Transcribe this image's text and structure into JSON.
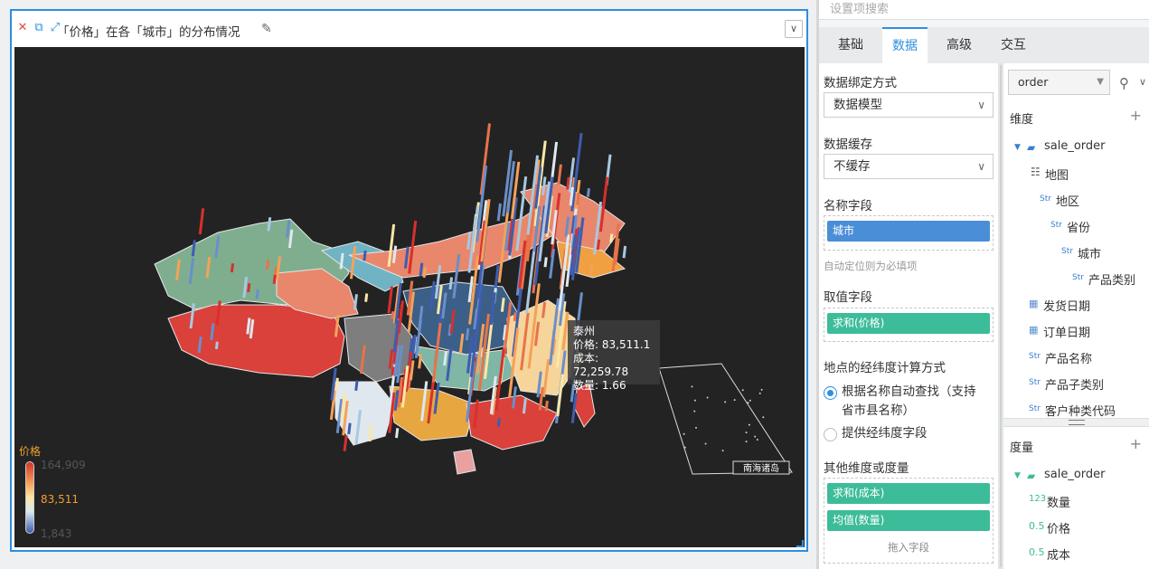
{
  "widget": {
    "title": "「价格」在各「城市」的分布情况",
    "tooltip": {
      "name": "泰州",
      "lines": [
        "价格: 83,511.1",
        "成本: 72,259.78",
        "数量: 1.66"
      ]
    },
    "legend": {
      "title": "价格",
      "max": "164,909",
      "mid": "83,511",
      "min": "1,843"
    },
    "inset_label": "南海诸岛"
  },
  "colors": {
    "accent": "#2d8fe0",
    "pill_blue": "#4a8ed8",
    "pill_green": "#3dbc9a",
    "canvas": "#232323"
  },
  "search": {
    "placeholder": "设置项搜索"
  },
  "tabs": [
    "基础",
    "数据",
    "高级",
    "交互"
  ],
  "settings": {
    "binding_label": "数据绑定方式",
    "binding_value": "数据模型",
    "cache_label": "数据缓存",
    "cache_value": "不缓存",
    "name_field_label": "名称字段",
    "name_field_value": "城市",
    "name_field_hint": "自动定位则为必填项",
    "value_field_label": "取值字段",
    "value_field_value": "求和(价格)",
    "coord_label": "地点的经纬度计算方式",
    "coord_option1_line1": "根据名称自动查找（支持",
    "coord_option1_line2": "省市县名称）",
    "coord_option2": "提供经纬度字段",
    "other_label": "其他维度或度量",
    "other_values": [
      "求和(成本)",
      "均值(数量)"
    ],
    "drop_hint": "拖入字段"
  },
  "fields": {
    "model": "order",
    "dimension_label": "维度",
    "measure_label": "度量",
    "dimension_folder": "sale_order",
    "dimension_items": [
      {
        "type": "hier",
        "label": "地图"
      },
      {
        "type": "Str",
        "label": "地区"
      },
      {
        "type": "Str",
        "label": "省份"
      },
      {
        "type": "Str",
        "label": "城市"
      },
      {
        "type": "Str",
        "label": "产品类别"
      },
      {
        "type": "date",
        "label": "发货日期"
      },
      {
        "type": "date",
        "label": "订单日期"
      },
      {
        "type": "Str",
        "label": "产品名称"
      },
      {
        "type": "Str",
        "label": "产品子类别"
      },
      {
        "type": "Str",
        "label": "客户种类代码"
      }
    ],
    "measure_folder": "sale_order",
    "measure_items": [
      {
        "type": "123",
        "label": "数量"
      },
      {
        "type": "0.5",
        "label": "价格"
      },
      {
        "type": "0.5",
        "label": "成本"
      }
    ]
  }
}
